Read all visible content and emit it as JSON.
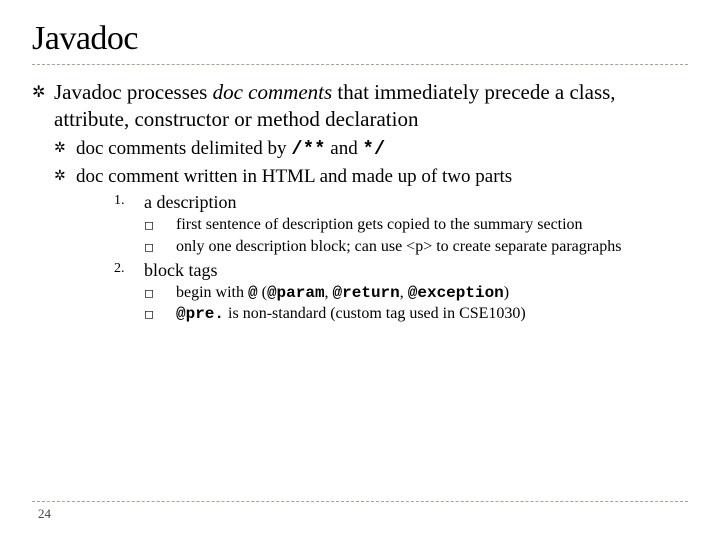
{
  "title": "Javadoc",
  "main": {
    "text_pre_em": "Javadoc processes ",
    "em": "doc comments",
    "text_post_em": " that immediately precede a class, attribute, constructor or method declaration"
  },
  "sub": [
    {
      "pre": "doc comments delimited by ",
      "code1": "/**",
      "mid": " and ",
      "code2": "*/"
    },
    {
      "pre": "doc comment written in HTML and made up of two parts"
    }
  ],
  "parts": [
    {
      "num": "1.",
      "label": "a description",
      "items": [
        {
          "text": "first sentence of description gets copied to the summary section"
        },
        {
          "text": "only one description block; can use <p> to create separate paragraphs"
        }
      ]
    },
    {
      "num": "2.",
      "label": "block tags",
      "items": [
        {
          "pre": "begin with ",
          "c1": "@",
          "mid1": " (",
          "c2": "@param",
          "mid2": ", ",
          "c3": "@return",
          "mid3": ", ",
          "c4": "@exception",
          "post": ")"
        },
        {
          "c1": "@pre.",
          "post": " is non-standard (custom tag used in CSE1030)"
        }
      ]
    }
  ],
  "page": "24"
}
